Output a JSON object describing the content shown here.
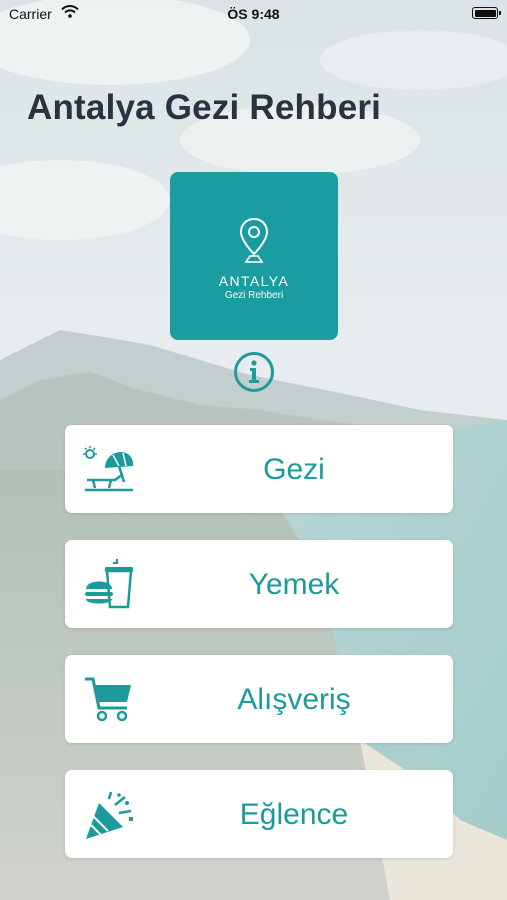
{
  "status_bar": {
    "carrier": "Carrier",
    "time": "ÖS 9:48"
  },
  "header": {
    "title": "Antalya Gezi Rehberi"
  },
  "logo": {
    "line1": "ANTALYA",
    "line2": "Gezi Rehberi",
    "icon": "map-pin-icon"
  },
  "info_button": {
    "icon": "info-icon"
  },
  "menu": [
    {
      "label": "Gezi",
      "icon": "beach-umbrella-icon"
    },
    {
      "label": "Yemek",
      "icon": "fast-food-icon"
    },
    {
      "label": "Alışveriş",
      "icon": "shopping-cart-icon"
    },
    {
      "label": "Eğlence",
      "icon": "party-popper-icon"
    }
  ],
  "colors": {
    "accent": "#1d9a9c",
    "logo_background": "#1a9da0",
    "title_text": "#2c3240",
    "button_background": "#ffffff"
  }
}
